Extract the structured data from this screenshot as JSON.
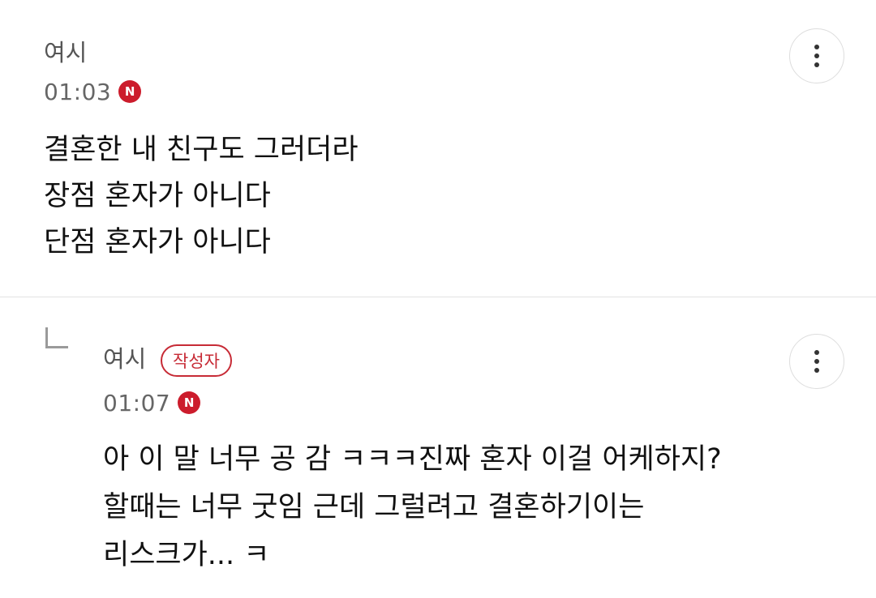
{
  "comments": [
    {
      "author": "여시",
      "time": "01:03",
      "new_badge": "N",
      "lines": [
        "결혼한 내 친구도 그러더라",
        "장점 혼자가 아니다",
        "단점 혼자가 아니다"
      ],
      "is_reply": false
    },
    {
      "author": "여시",
      "author_badge": "작성자",
      "time": "01:07",
      "new_badge": "N",
      "lines": [
        "아 이 말 너무 공 감 ㅋㅋㅋ진짜 혼자 이걸 어케하지?",
        "할때는 너무 굿임 근데 그럴려고 결혼하기이는",
        "리스크가... ㅋ"
      ],
      "is_reply": true
    }
  ],
  "icons": {
    "more": "more-vertical-icon",
    "reply": "reply-arrow-icon"
  },
  "colors": {
    "new_badge_bg": "#cc1c2c",
    "author_badge": "#c72b36",
    "divider": "#e2e2e2"
  }
}
